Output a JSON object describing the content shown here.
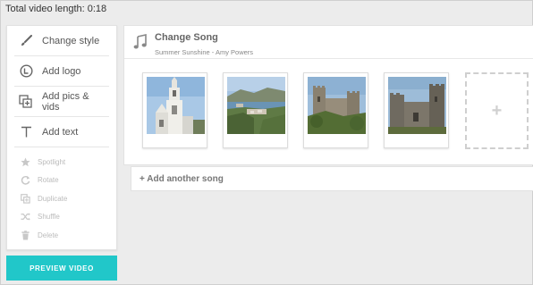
{
  "header": {
    "total_length": "Total video length: 0:18"
  },
  "sidebar": {
    "primary": [
      {
        "label": "Change style",
        "icon": "brush-icon"
      },
      {
        "label": "Add logo",
        "icon": "logo-icon"
      },
      {
        "label": "Add pics & vids",
        "icon": "add-media-icon"
      },
      {
        "label": "Add text",
        "icon": "text-icon"
      }
    ],
    "secondary": [
      {
        "label": "Spotlight",
        "icon": "star-icon"
      },
      {
        "label": "Rotate",
        "icon": "rotate-icon"
      },
      {
        "label": "Duplicate",
        "icon": "duplicate-icon"
      },
      {
        "label": "Shuffle",
        "icon": "shuffle-icon"
      },
      {
        "label": "Delete",
        "icon": "trash-icon"
      }
    ],
    "preview_label": "PREVIEW VIDEO"
  },
  "song": {
    "title": "Change Song",
    "subtitle": "Summer Sunshine - Amy Powers",
    "add_label": "+"
  },
  "add_song_label": "+ Add another song",
  "colors": {
    "accent": "#21c7c9"
  }
}
